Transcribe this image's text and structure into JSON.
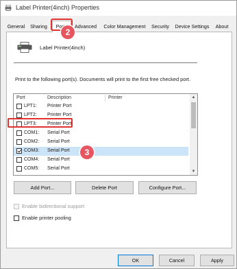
{
  "window": {
    "title": "Label Printer(4inch) Properties"
  },
  "tabs": [
    {
      "label": "General"
    },
    {
      "label": "Sharing"
    },
    {
      "label": "Ports"
    },
    {
      "label": "Advanced"
    },
    {
      "label": "Color Management"
    },
    {
      "label": "Security"
    },
    {
      "label": "Device Settings"
    },
    {
      "label": "About"
    }
  ],
  "annotations": {
    "step_tab": "2",
    "step_port": "3"
  },
  "printer": {
    "name": "Label Printer(4inch)"
  },
  "ports_description": "Print to the following port(s). Documents will print to the first free checked port.",
  "port_list": {
    "headers": {
      "port": "Port",
      "description": "Description",
      "printer": "Printer"
    },
    "rows": [
      {
        "port": "LPT1:",
        "description": "Printer Port",
        "checked": false
      },
      {
        "port": "LPT2:",
        "description": "Printer Port",
        "checked": false
      },
      {
        "port": "LPT3:",
        "description": "Printer Port",
        "checked": false
      },
      {
        "port": "COM1:",
        "description": "Serial Port",
        "checked": false
      },
      {
        "port": "COM2:",
        "description": "Serial Port",
        "checked": false
      },
      {
        "port": "COM3:",
        "description": "Serial Port",
        "checked": true,
        "selected": true
      },
      {
        "port": "COM4:",
        "description": "Serial Port",
        "checked": false
      },
      {
        "port": "COM5:",
        "description": "Serial Port",
        "checked": false
      }
    ]
  },
  "buttons": {
    "add_port": "Add Port...",
    "delete_port": "Delete Port",
    "configure_port": "Configure Port..."
  },
  "options": {
    "bidirectional": {
      "label": "Enable bidirectional support",
      "checked": false,
      "disabled": true
    },
    "pooling": {
      "label": "Enable printer pooling",
      "checked": false,
      "disabled": false
    }
  },
  "footer": {
    "ok": "OK",
    "cancel": "Cancel",
    "apply": "Apply"
  },
  "colors": {
    "highlight": "#e0332f",
    "badge": "#e65560",
    "selection": "#cce4f7"
  }
}
